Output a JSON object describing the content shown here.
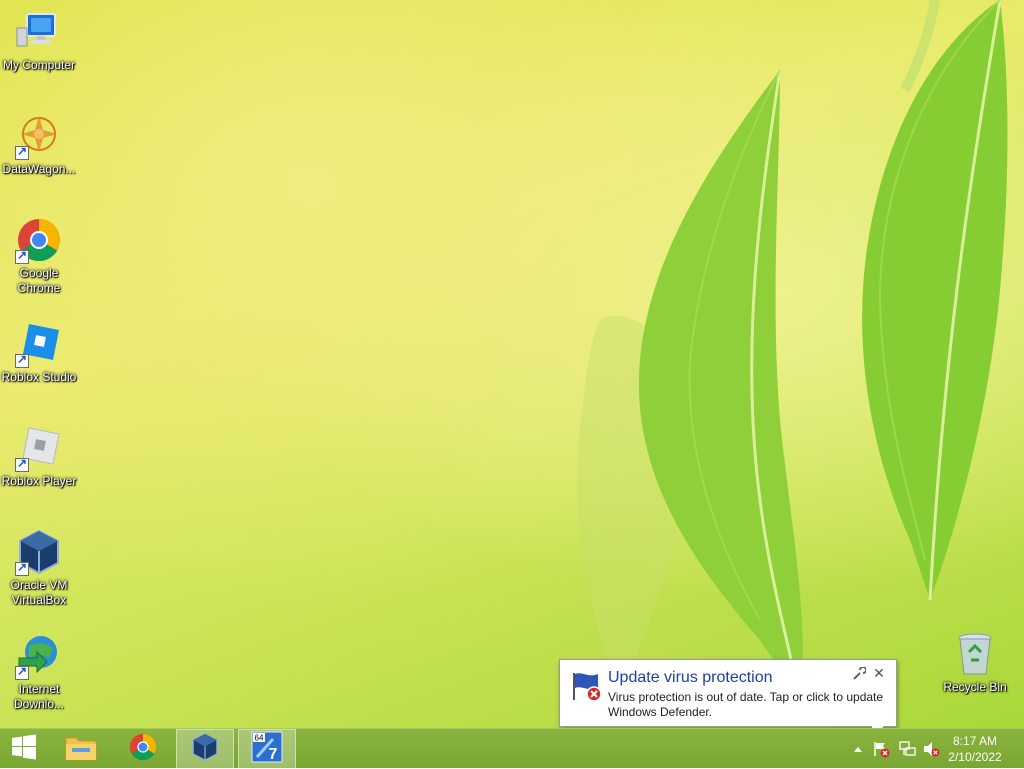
{
  "desktop": {
    "icons": [
      {
        "label": "My Computer",
        "icon": "computer-icon",
        "shortcut": false
      },
      {
        "label": "DataWagon...",
        "icon": "datawagon-icon",
        "shortcut": true
      },
      {
        "label": "Google Chrome",
        "icon": "chrome-icon",
        "shortcut": true
      },
      {
        "label": "Roblox Studio",
        "icon": "roblox-studio-icon",
        "shortcut": true
      },
      {
        "label": "Roblox Player",
        "icon": "roblox-player-icon",
        "shortcut": true
      },
      {
        "label": "Oracle VM VirtualBox",
        "icon": "virtualbox-icon",
        "shortcut": true
      },
      {
        "label": "Internet Downlo...",
        "icon": "internet-download-manager-icon",
        "shortcut": true
      }
    ],
    "recycle_bin": {
      "label": "Recycle Bin",
      "icon": "recycle-bin-icon"
    }
  },
  "toast": {
    "title": "Update virus protection",
    "body": "Virus protection is out of date. Tap or click to update Windows Defender.",
    "icon": "defender-flag-error-icon"
  },
  "taskbar": {
    "start": "windows-logo-icon",
    "pinned": [
      "file-explorer-icon",
      "chrome-icon",
      "virtualbox-icon",
      "unknown-app-64-7-icon"
    ],
    "tray": [
      "show-hidden-icons-chevron",
      "action-center-flag-error-icon",
      "network-icon",
      "speaker-muted-icon"
    ],
    "clock": {
      "time": "8:17 AM",
      "date": "2/10/2022"
    }
  },
  "colors": {
    "taskbar": "#7aa632",
    "toast_title": "#1d3fa8",
    "desktop_label": "#ffffff"
  }
}
